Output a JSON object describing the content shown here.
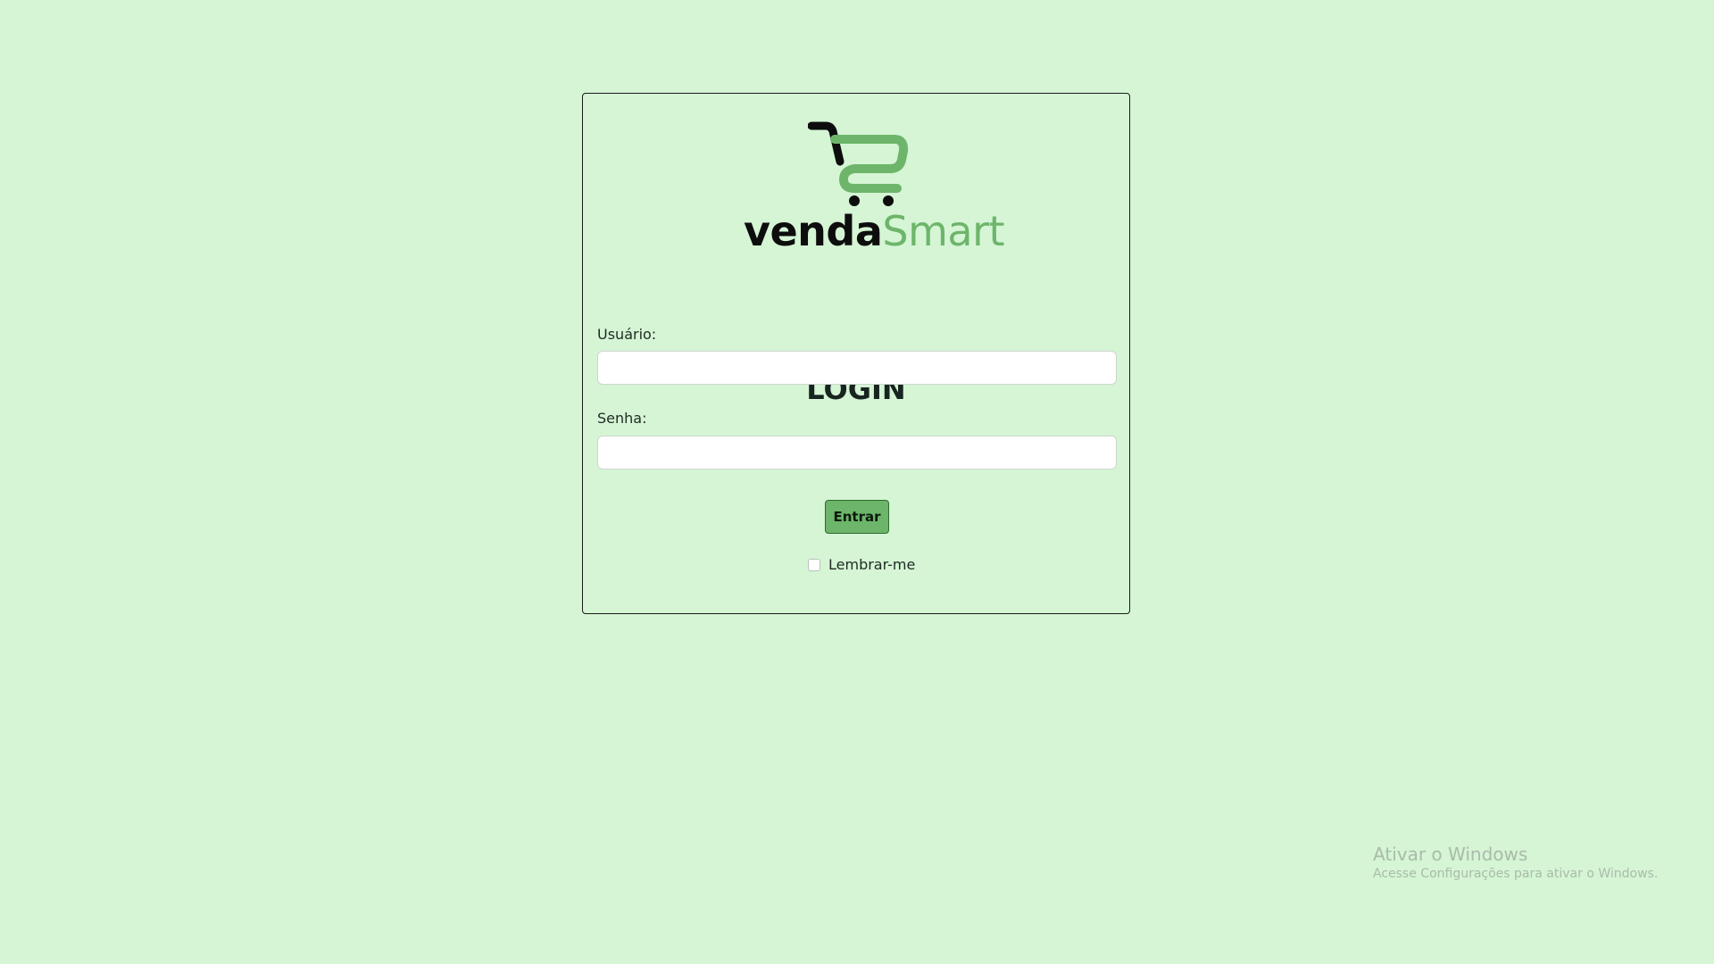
{
  "brand": {
    "logo_word_1": "venda",
    "logo_word_2": "Smart",
    "logo_icon": "shopping-cart-icon",
    "accent_color": "#6cb56a",
    "dark_color": "#0d0d0d"
  },
  "page": {
    "background_color": "#d5f5d5"
  },
  "form": {
    "title": "LOGIN",
    "username_label": "Usuário:",
    "username_value": "",
    "password_label": "Senha:",
    "password_value": "",
    "submit_label": "Entrar",
    "remember_label": "Lembrar-me",
    "remember_checked": false
  },
  "watermark": {
    "title": "Ativar o Windows",
    "subtitle": "Acesse Configurações para ativar o Windows."
  }
}
